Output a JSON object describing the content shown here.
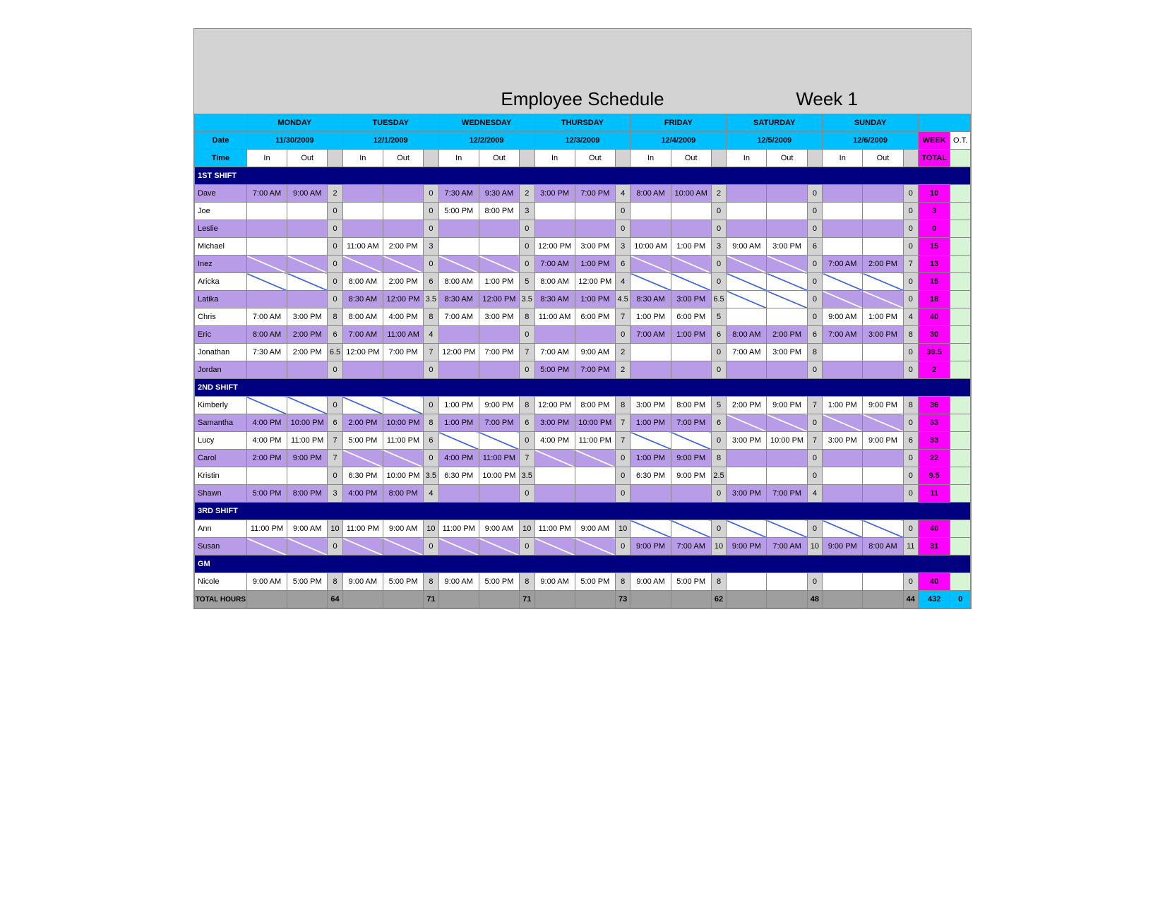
{
  "title": "Employee Schedule",
  "week_label": "Week 1",
  "hdr": {
    "date": "Date",
    "time": "Time",
    "in": "In",
    "out": "Out",
    "week": "WEEK",
    "ot": "O.T.",
    "total": "TOTAL",
    "totalhours": "TOTAL HOURS"
  },
  "days": [
    {
      "name": "MONDAY",
      "date": "11/30/2009"
    },
    {
      "name": "TUESDAY",
      "date": "12/1/2009"
    },
    {
      "name": "WEDNESDAY",
      "date": "12/2/2009"
    },
    {
      "name": "THURSDAY",
      "date": "12/3/2009"
    },
    {
      "name": "FRIDAY",
      "date": "12/4/2009"
    },
    {
      "name": "SATURDAY",
      "date": "12/5/2009"
    },
    {
      "name": "SUNDAY",
      "date": "12/6/2009"
    }
  ],
  "sections": [
    {
      "label": "1ST SHIFT",
      "rows": [
        {
          "n": "Dave",
          "alt": 1,
          "d": [
            [
              "7:00 AM",
              "9:00 AM",
              "2"
            ],
            [
              "",
              "",
              "0"
            ],
            [
              "7:30 AM",
              "9:30 AM",
              "2"
            ],
            [
              "3:00 PM",
              "7:00 PM",
              "4"
            ],
            [
              "8:00 AM",
              "10:00 AM",
              "2"
            ],
            [
              "",
              "",
              "0"
            ],
            [
              "",
              "",
              "0"
            ]
          ],
          "wk": "10",
          "ot": ""
        },
        {
          "n": "Joe",
          "alt": 0,
          "d": [
            [
              "",
              "",
              "0"
            ],
            [
              "",
              "",
              "0"
            ],
            [
              "5:00 PM",
              "8:00 PM",
              "3"
            ],
            [
              "",
              "",
              "0"
            ],
            [
              "",
              "",
              "0"
            ],
            [
              "",
              "",
              "0"
            ],
            [
              "",
              "",
              "0"
            ]
          ],
          "wk": "3",
          "ot": ""
        },
        {
          "n": "Leslie",
          "alt": 1,
          "d": [
            [
              "",
              "",
              "0"
            ],
            [
              "",
              "",
              "0"
            ],
            [
              "",
              "",
              "0"
            ],
            [
              "",
              "",
              "0"
            ],
            [
              "",
              "",
              "0"
            ],
            [
              "",
              "",
              "0"
            ],
            [
              "",
              "",
              "0"
            ]
          ],
          "wk": "0",
          "ot": ""
        },
        {
          "n": "Michael",
          "alt": 0,
          "d": [
            [
              "",
              "",
              "0"
            ],
            [
              "11:00 AM",
              "2:00 PM",
              "3"
            ],
            [
              "",
              "",
              "0"
            ],
            [
              "12:00 PM",
              "3:00 PM",
              "3"
            ],
            [
              "10:00 AM",
              "1:00 PM",
              "3"
            ],
            [
              "9:00 AM",
              "3:00 PM",
              "6"
            ],
            [
              "",
              "",
              "0"
            ]
          ],
          "wk": "15",
          "ot": ""
        },
        {
          "n": "Inez",
          "alt": 1,
          "d": [
            [
              "/",
              "/",
              "0"
            ],
            [
              "/",
              "/",
              "0"
            ],
            [
              "/",
              "/",
              "0"
            ],
            [
              "7:00 AM",
              "1:00 PM",
              "6"
            ],
            [
              "/",
              "/",
              "0"
            ],
            [
              "/",
              "/",
              "0"
            ],
            [
              "7:00 AM",
              "2:00 PM",
              "7"
            ]
          ],
          "wk": "13",
          "ot": ""
        },
        {
          "n": "Aricka",
          "alt": 0,
          "d": [
            [
              "\\",
              "\\",
              "0"
            ],
            [
              "8:00 AM",
              "2:00 PM",
              "6"
            ],
            [
              "8:00 AM",
              "1:00 PM",
              "5"
            ],
            [
              "8:00 AM",
              "12:00 PM",
              "4"
            ],
            [
              "\\",
              "\\",
              "0"
            ],
            [
              "\\",
              "\\",
              "0"
            ],
            [
              "\\",
              "\\",
              "0"
            ]
          ],
          "wk": "15",
          "ot": ""
        },
        {
          "n": "Latika",
          "alt": 1,
          "d": [
            [
              "",
              "",
              "0"
            ],
            [
              "8:30 AM",
              "12:00 PM",
              "3.5"
            ],
            [
              "8:30 AM",
              "12:00 PM",
              "3.5"
            ],
            [
              "8:30 AM",
              "1:00 PM",
              "4.5"
            ],
            [
              "8:30 AM",
              "3:00 PM",
              "6.5"
            ],
            [
              "\\",
              "\\",
              "0"
            ],
            [
              "/",
              "/",
              "0"
            ]
          ],
          "wk": "18",
          "ot": ""
        },
        {
          "n": "Chris",
          "alt": 0,
          "d": [
            [
              "7:00 AM",
              "3:00 PM",
              "8"
            ],
            [
              "8:00 AM",
              "4:00 PM",
              "8"
            ],
            [
              "7:00 AM",
              "3:00 PM",
              "8"
            ],
            [
              "11:00 AM",
              "6:00 PM",
              "7"
            ],
            [
              "1:00 PM",
              "6:00 PM",
              "5"
            ],
            [
              "",
              "",
              "0"
            ],
            [
              "9:00 AM",
              "1:00 PM",
              "4"
            ]
          ],
          "wk": "40",
          "ot": ""
        },
        {
          "n": "Eric",
          "alt": 1,
          "d": [
            [
              "8:00 AM",
              "2:00 PM",
              "6"
            ],
            [
              "7:00 AM",
              "11:00 AM",
              "4"
            ],
            [
              "",
              "",
              "0"
            ],
            [
              "",
              "",
              "0"
            ],
            [
              "7:00 AM",
              "1:00 PM",
              "6"
            ],
            [
              "8:00 AM",
              "2:00 PM",
              "6"
            ],
            [
              "7:00 AM",
              "3:00 PM",
              "8"
            ]
          ],
          "wk": "30",
          "ot": ""
        },
        {
          "n": "Jonathan",
          "alt": 0,
          "d": [
            [
              "7:30 AM",
              "2:00 PM",
              "6.5"
            ],
            [
              "12:00 PM",
              "7:00 PM",
              "7"
            ],
            [
              "12:00 PM",
              "7:00 PM",
              "7"
            ],
            [
              "7:00 AM",
              "9:00 AM",
              "2"
            ],
            [
              "",
              "",
              "0"
            ],
            [
              "7:00 AM",
              "3:00 PM",
              "8"
            ],
            [
              "",
              "",
              "0"
            ]
          ],
          "wk": "30.5",
          "ot": ""
        },
        {
          "n": "Jordan",
          "alt": 1,
          "d": [
            [
              "",
              "",
              "0"
            ],
            [
              "",
              "",
              "0"
            ],
            [
              "",
              "",
              "0"
            ],
            [
              "5:00 PM",
              "7:00 PM",
              "2"
            ],
            [
              "",
              "",
              "0"
            ],
            [
              "",
              "",
              "0"
            ],
            [
              "",
              "",
              "0"
            ]
          ],
          "wk": "2",
          "ot": ""
        }
      ]
    },
    {
      "label": "2ND SHIFT",
      "rows": [
        {
          "n": "Kimberly",
          "alt": 0,
          "d": [
            [
              "\\",
              "\\",
              "0"
            ],
            [
              "\\",
              "\\",
              "0"
            ],
            [
              "1:00 PM",
              "9:00 PM",
              "8"
            ],
            [
              "12:00 PM",
              "8:00 PM",
              "8"
            ],
            [
              "3:00 PM",
              "8:00 PM",
              "5"
            ],
            [
              "2:00 PM",
              "9:00 PM",
              "7"
            ],
            [
              "1:00 PM",
              "9:00 PM",
              "8"
            ]
          ],
          "wk": "36",
          "ot": ""
        },
        {
          "n": "Samantha",
          "alt": 1,
          "d": [
            [
              "4:00 PM",
              "10:00 PM",
              "6"
            ],
            [
              "2:00 PM",
              "10:00 PM",
              "8"
            ],
            [
              "1:00 PM",
              "7:00 PM",
              "6"
            ],
            [
              "3:00 PM",
              "10:00 PM",
              "7"
            ],
            [
              "1:00 PM",
              "7:00 PM",
              "6"
            ],
            [
              "/",
              "/",
              "0"
            ],
            [
              "/",
              "/",
              "0"
            ]
          ],
          "wk": "33",
          "ot": ""
        },
        {
          "n": "Lucy",
          "alt": 0,
          "d": [
            [
              "4:00 PM",
              "11:00 PM",
              "7"
            ],
            [
              "5:00 PM",
              "11:00 PM",
              "6"
            ],
            [
              "\\",
              "\\",
              "0"
            ],
            [
              "4:00 PM",
              "11:00 PM",
              "7"
            ],
            [
              "\\",
              "\\",
              "0"
            ],
            [
              "3:00 PM",
              "10:00 PM",
              "7"
            ],
            [
              "3:00 PM",
              "9:00 PM",
              "6"
            ]
          ],
          "wk": "33",
          "ot": ""
        },
        {
          "n": "Carol",
          "alt": 1,
          "d": [
            [
              "2:00 PM",
              "9:00 PM",
              "7"
            ],
            [
              "/",
              "/",
              "0"
            ],
            [
              "4:00 PM",
              "11:00 PM",
              "7"
            ],
            [
              "/",
              "/",
              "0"
            ],
            [
              "1:00 PM",
              "9:00 PM",
              "8"
            ],
            [
              "",
              "",
              "0"
            ],
            [
              "",
              "",
              "0"
            ]
          ],
          "wk": "22",
          "ot": ""
        },
        {
          "n": "Kristin",
          "alt": 0,
          "d": [
            [
              "",
              "",
              "0"
            ],
            [
              "6:30 PM",
              "10:00 PM",
              "3.5"
            ],
            [
              "6:30 PM",
              "10:00 PM",
              "3.5"
            ],
            [
              "",
              "",
              "0"
            ],
            [
              "6:30 PM",
              "9:00 PM",
              "2.5"
            ],
            [
              "",
              "",
              "0"
            ],
            [
              "",
              "",
              "0"
            ]
          ],
          "wk": "9.5",
          "ot": ""
        },
        {
          "n": "Shawn",
          "alt": 1,
          "d": [
            [
              "5:00 PM",
              "8:00 PM",
              "3"
            ],
            [
              "4:00 PM",
              "8:00 PM",
              "4"
            ],
            [
              "",
              "",
              "0"
            ],
            [
              "",
              "",
              "0"
            ],
            [
              "",
              "",
              "0"
            ],
            [
              "3:00 PM",
              "7:00 PM",
              "4"
            ],
            [
              "",
              "",
              "0"
            ]
          ],
          "wk": "11",
          "ot": ""
        }
      ]
    },
    {
      "label": "3RD SHIFT",
      "rows": [
        {
          "n": "Ann",
          "alt": 0,
          "d": [
            [
              "11:00 PM",
              "9:00 AM",
              "10"
            ],
            [
              "11:00 PM",
              "9:00 AM",
              "10"
            ],
            [
              "11:00 PM",
              "9:00 AM",
              "10"
            ],
            [
              "11:00 PM",
              "9:00 AM",
              "10"
            ],
            [
              "\\",
              "\\",
              "0"
            ],
            [
              "\\",
              "\\",
              "0"
            ],
            [
              "\\",
              "\\",
              "0"
            ]
          ],
          "wk": "40",
          "ot": ""
        },
        {
          "n": "Susan",
          "alt": 1,
          "d": [
            [
              "/",
              "/",
              "0"
            ],
            [
              "/",
              "/",
              "0"
            ],
            [
              "/",
              "/",
              "0"
            ],
            [
              "/",
              "/",
              "0"
            ],
            [
              "9:00 PM",
              "7:00 AM",
              "10"
            ],
            [
              "9:00 PM",
              "7:00 AM",
              "10"
            ],
            [
              "9:00 PM",
              "8:00 AM",
              "11"
            ]
          ],
          "wk": "31",
          "ot": ""
        }
      ]
    },
    {
      "label": "GM",
      "rows": [
        {
          "n": "Nicole",
          "alt": 0,
          "d": [
            [
              "9:00 AM",
              "5:00 PM",
              "8"
            ],
            [
              "9:00 AM",
              "5:00 PM",
              "8"
            ],
            [
              "9:00 AM",
              "5:00 PM",
              "8"
            ],
            [
              "9:00 AM",
              "5:00 PM",
              "8"
            ],
            [
              "9:00 AM",
              "5:00 PM",
              "8"
            ],
            [
              "",
              "",
              "0"
            ],
            [
              "",
              "",
              "0"
            ]
          ],
          "wk": "40",
          "ot": ""
        }
      ]
    }
  ],
  "totals": {
    "days": [
      "64",
      "71",
      "71",
      "73",
      "62",
      "48",
      "44"
    ],
    "week": "432",
    "ot": "0"
  }
}
